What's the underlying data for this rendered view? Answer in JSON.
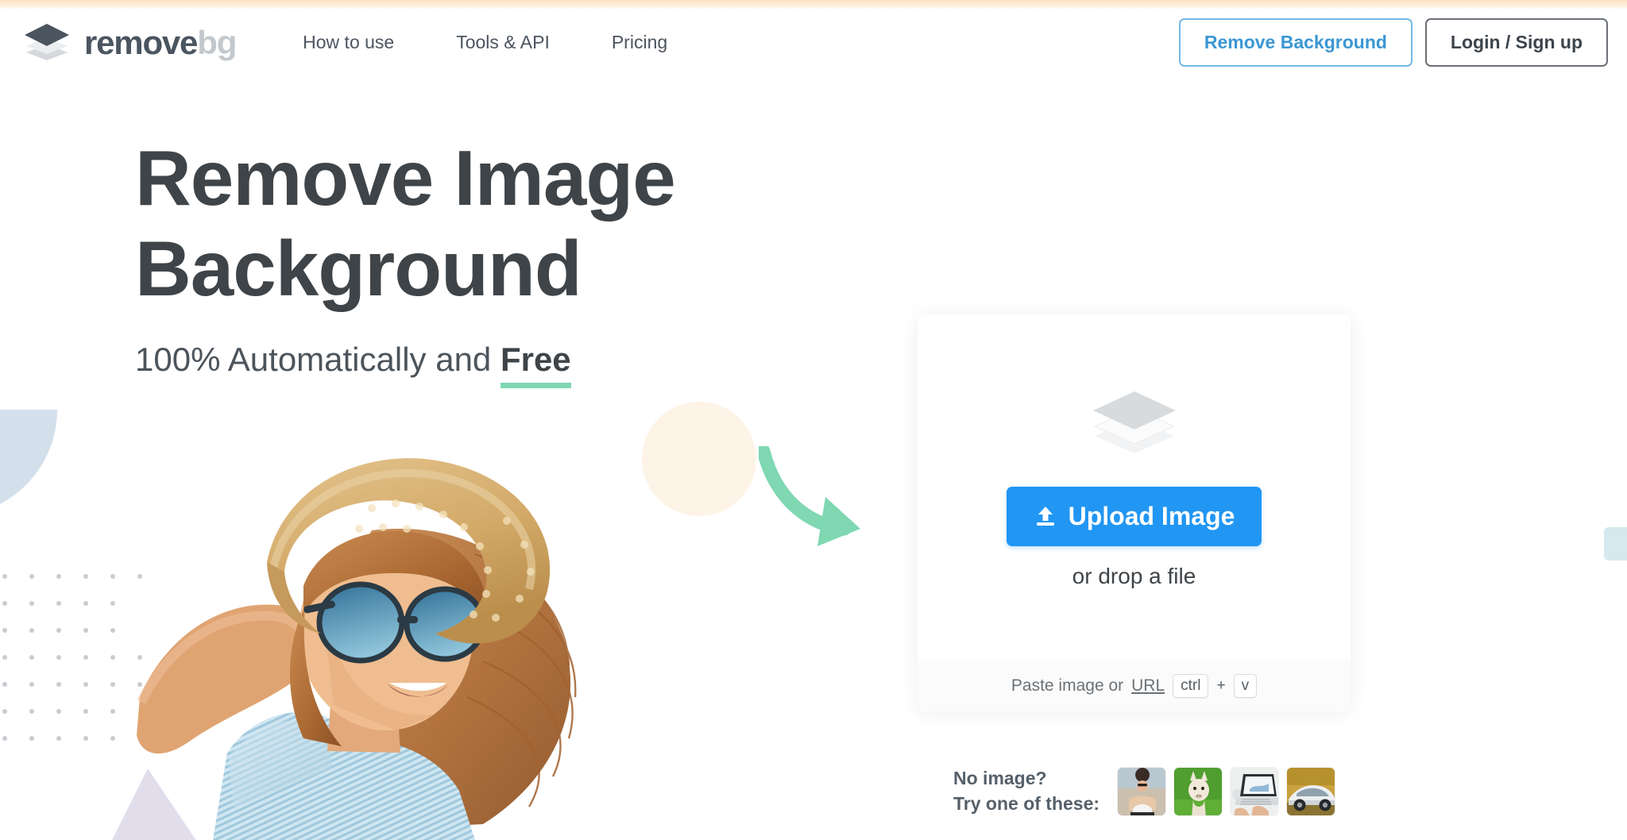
{
  "brand": {
    "name_primary": "remove",
    "name_secondary": "bg",
    "logo_icon": "stacked-layers-icon"
  },
  "nav": {
    "links": [
      {
        "label": "How to use"
      },
      {
        "label": "Tools & API"
      },
      {
        "label": "Pricing"
      }
    ],
    "cta_primary": "Remove Background",
    "cta_secondary": "Login / Sign up"
  },
  "hero": {
    "title": "Remove Image\nBackground",
    "subtitle_prefix": "100% Automatically and ",
    "subtitle_emphasis": "Free"
  },
  "upload": {
    "icon": "stacked-layers-icon",
    "button_icon": "upload-arrow-icon",
    "button_label": "Upload Image",
    "drop_hint": "or drop a file",
    "paste_text": "Paste image or",
    "paste_link": "URL",
    "key_ctrl": "ctrl",
    "key_plus": "+",
    "key_v": "v"
  },
  "samples": {
    "label": "No image?\nTry one of these:",
    "thumbnails": [
      {
        "name": "woman-sunglasses-thumbnail"
      },
      {
        "name": "alpaca-thumbnail"
      },
      {
        "name": "laptop-hands-thumbnail"
      },
      {
        "name": "sports-car-thumbnail"
      }
    ]
  },
  "decorations": {
    "arrow": "curved-arrow-icon",
    "hero_photo": "woman-in-straw-hat-photo"
  },
  "colors": {
    "accent_blue": "#2196f3",
    "link_blue": "#3b97d3",
    "green": "#7fd8b2",
    "heading": "#3f4448",
    "peach_strip": "#fbe3c4",
    "pale_blue": "#d3dfeb",
    "pale_purple": "#e2ddeb",
    "cream_circle": "#fdf3e6"
  }
}
